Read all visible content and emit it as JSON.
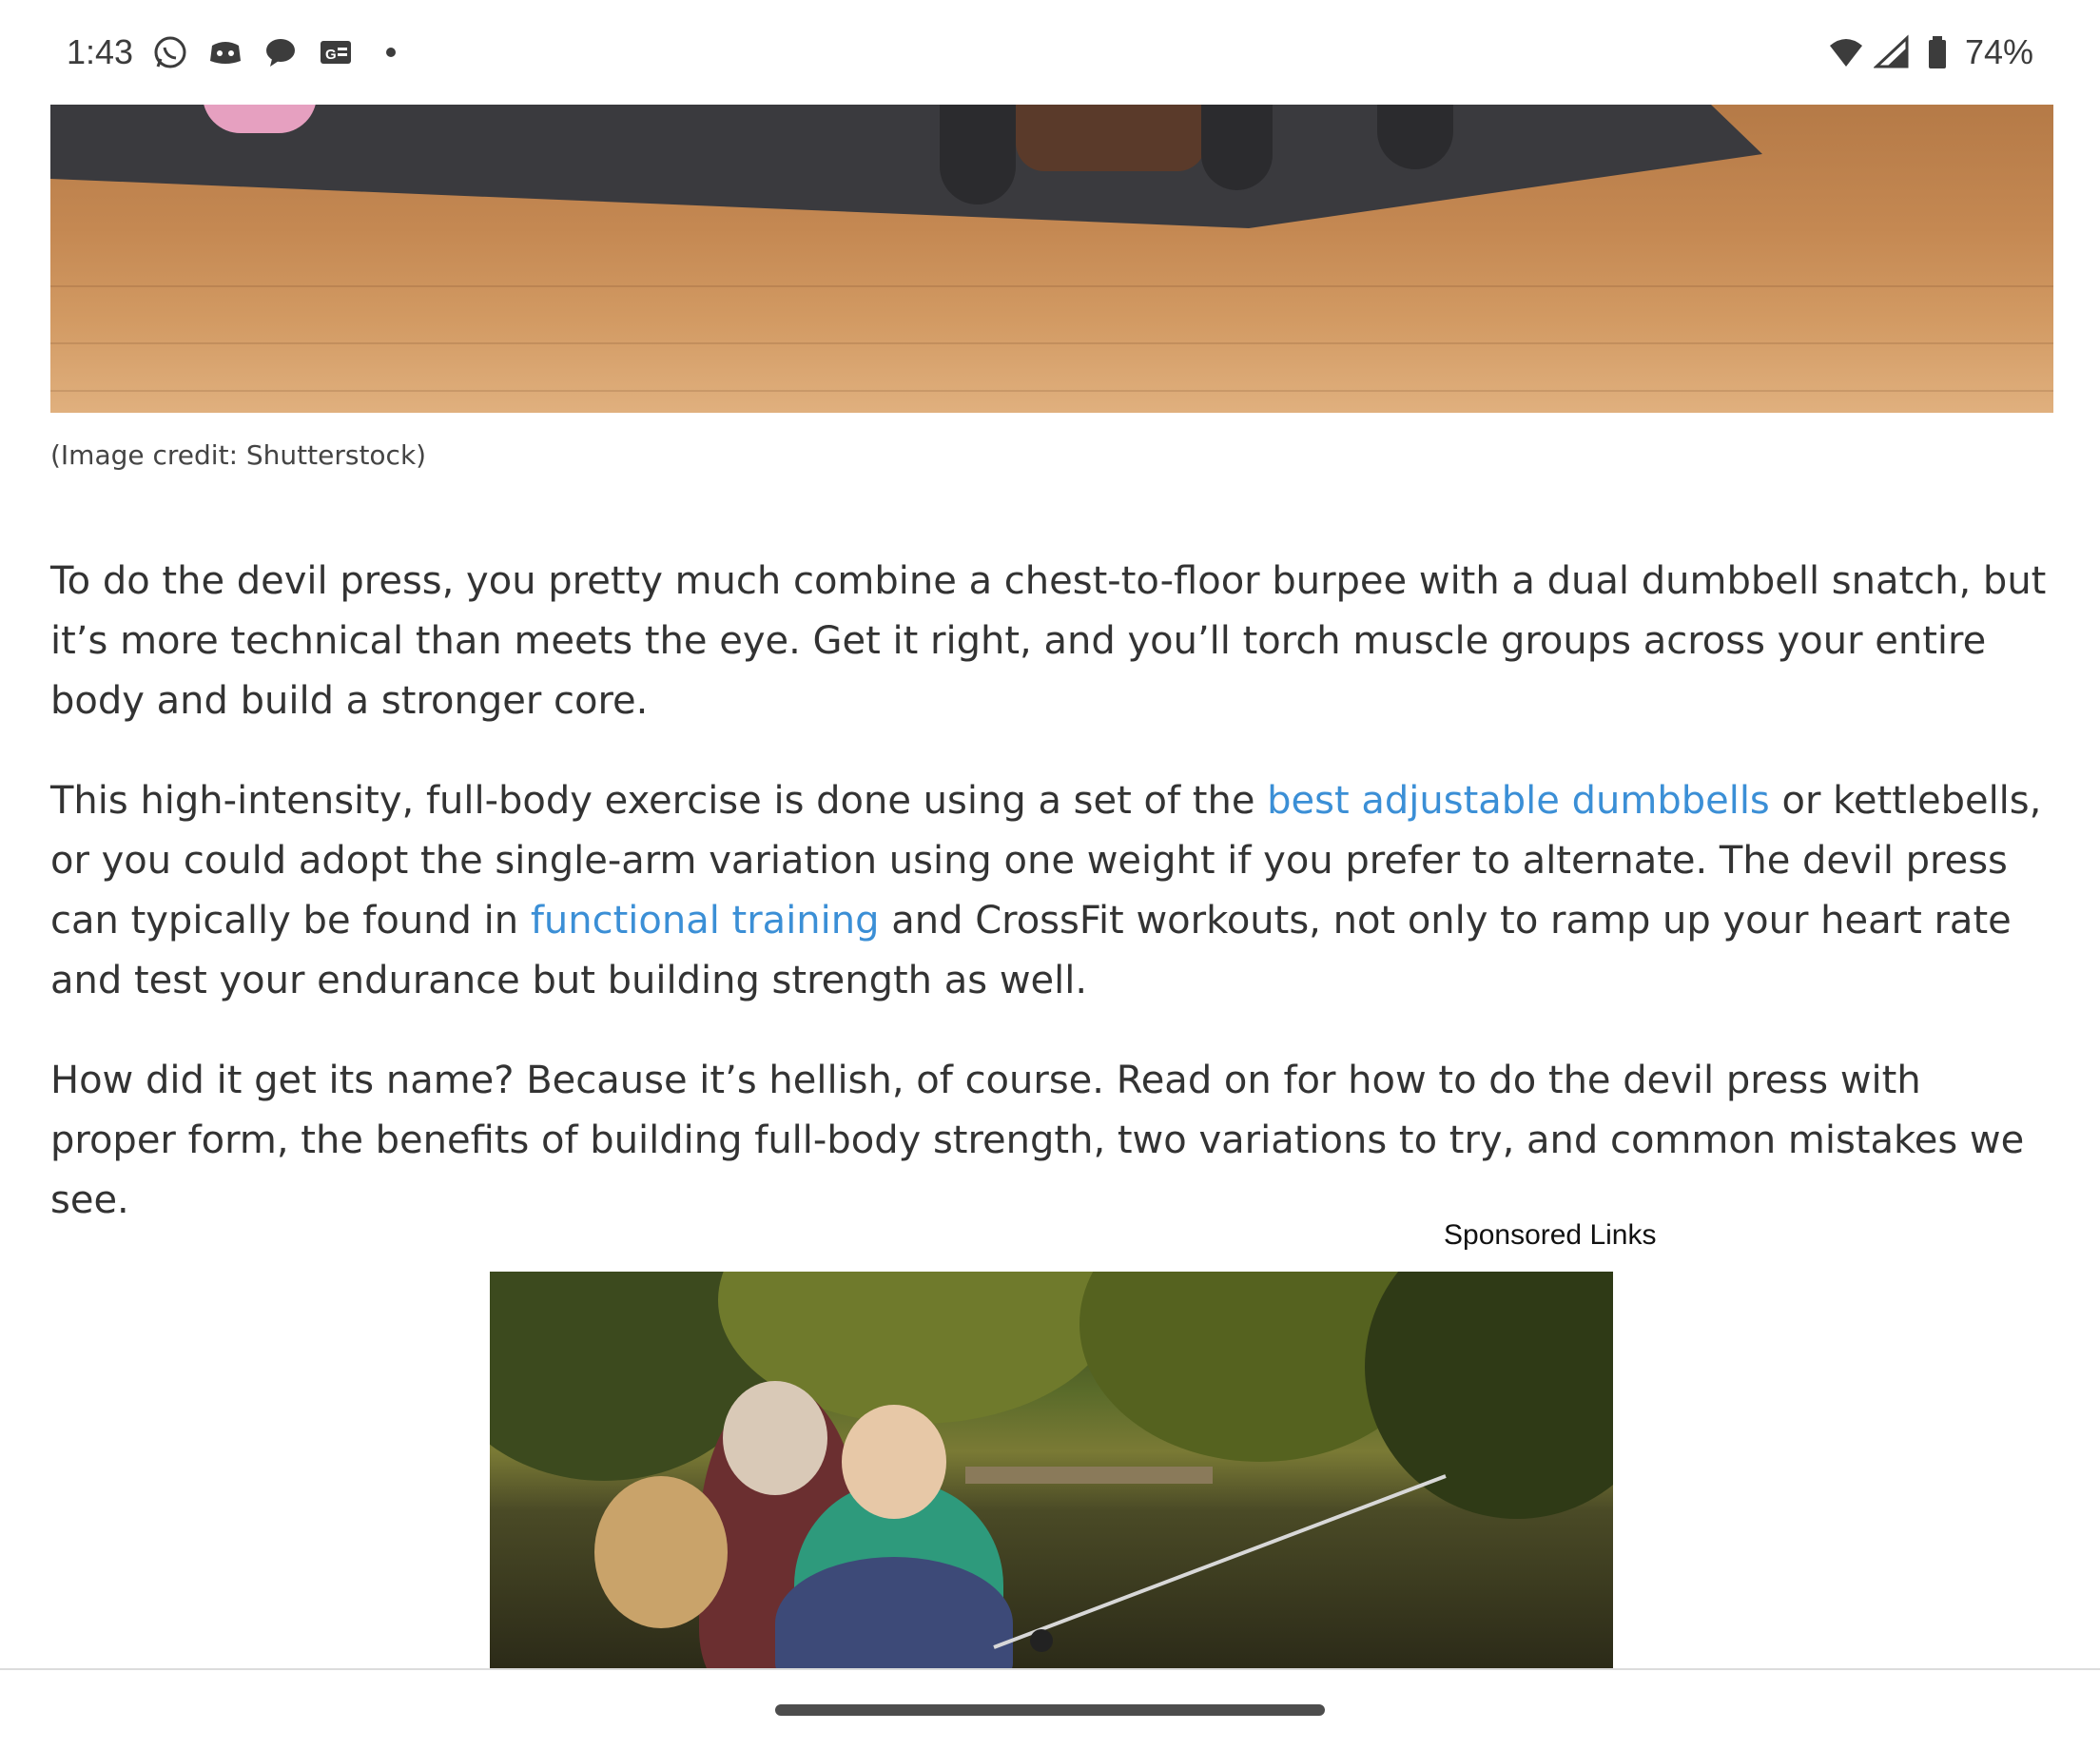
{
  "status_bar": {
    "time": "1:43",
    "battery": "74%",
    "icons": [
      "whatsapp-icon",
      "discord-icon",
      "chat-bubble-icon",
      "google-news-icon",
      "more-dot-icon",
      "wifi-icon",
      "signal-icon",
      "battery-icon"
    ]
  },
  "hero_image": {
    "caption": "(Image credit: Shutterstock)"
  },
  "article": {
    "p1": "To do the devil press, you pretty much combine a chest-to-floor burpee with a dual dumbbell snatch, but it’s more technical than meets the eye. Get it right, and you’ll torch muscle groups across your entire body and build a stronger core.",
    "p2_before_link1": "This high-intensity, full-body exercise is done using a set of the ",
    "p2_link1": "best adjustable dumbbells",
    "p2_between": " or kettlebells, or you could adopt the single-arm variation using one weight if you prefer to alternate. The devil press can typically be found in ",
    "p2_link2": "functional training",
    "p2_after": " and CrossFit workouts, not only to ramp up your heart rate and test your endurance but building strength as well.",
    "p3": "How did it get its name? Because it’s hellish, of course. Read on for how to do the devil press with proper form, the benefits of building full-body strength, two variations to try, and common mistakes we see."
  },
  "ad": {
    "label": "Sponsored Links"
  },
  "colors": {
    "link": "#3b8fd6",
    "text": "#333333"
  }
}
